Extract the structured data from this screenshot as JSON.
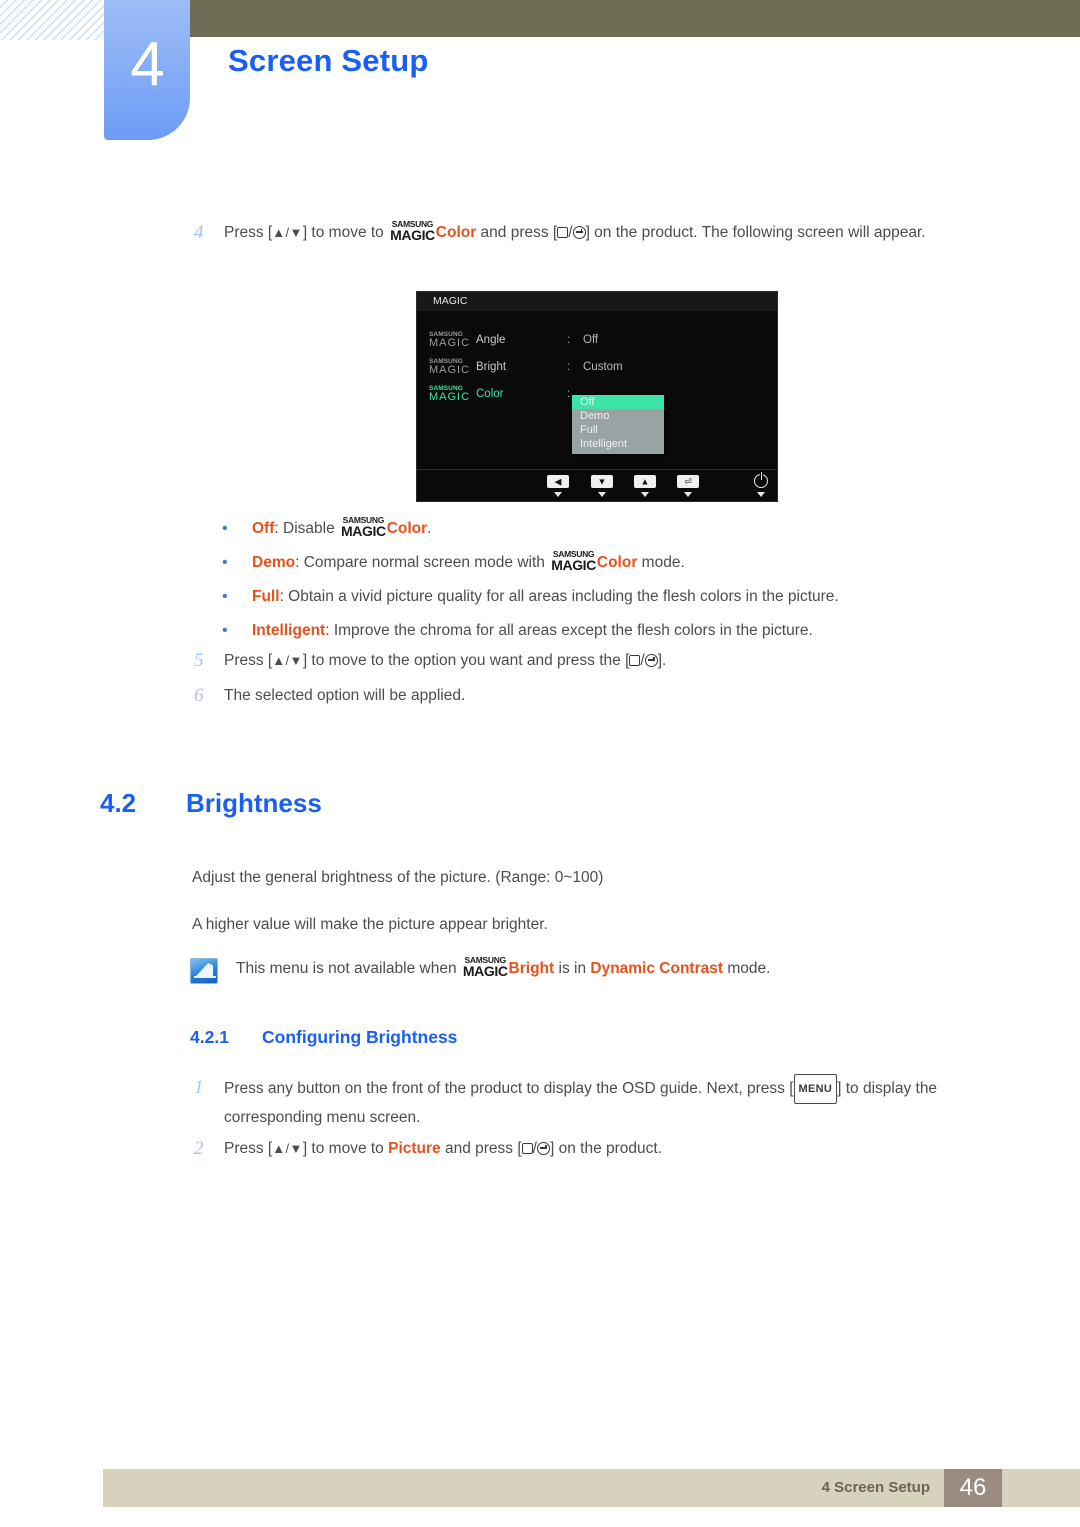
{
  "header": {
    "chapter_number": "4",
    "chapter_title": "Screen Setup"
  },
  "step4": {
    "num": "4",
    "t1": "Press [",
    "up": "▲",
    "slash": "/",
    "down": "▼",
    "t2": "] to move to ",
    "magic_s": "SAMSUNG",
    "magic_m": "MAGIC",
    "color": "Color",
    "t3": " and press [",
    "t4": "/",
    "t5": "] on the product. The following screen will appear."
  },
  "osd": {
    "title": "MAGIC",
    "magic_s": "SAMSUNG",
    "magic_m": "MAGIC",
    "colon": ":",
    "rows": [
      {
        "label": "Angle",
        "value": "Off"
      },
      {
        "label": "Bright",
        "value": "Custom"
      },
      {
        "label": "Color",
        "value": ""
      }
    ],
    "options": [
      "Off",
      "Demo",
      "Full",
      "Intelligent"
    ],
    "selected_option": "Off",
    "buttons": [
      "◀",
      "▼",
      "▲",
      "⏎"
    ],
    "power_label": "power"
  },
  "bullets": [
    {
      "dot": "•",
      "key": "Off",
      "mid": ": Disable ",
      "magic_s": "SAMSUNG",
      "magic_m": "MAGIC",
      "color": "Color",
      "tail": "."
    },
    {
      "dot": "•",
      "key": "Demo",
      "mid": ": Compare normal screen mode with ",
      "magic_s": "SAMSUNG",
      "magic_m": "MAGIC",
      "color": "Color",
      "tail": " mode."
    },
    {
      "dot": "•",
      "key": "Full",
      "mid": ": Obtain a vivid picture quality for all areas including the flesh colors in the picture.",
      "magic_s": "",
      "magic_m": "",
      "color": "",
      "tail": ""
    },
    {
      "dot": "•",
      "key": "Intelligent",
      "mid": ": Improve the chroma for all areas except the flesh colors in the picture.",
      "magic_s": "",
      "magic_m": "",
      "color": "",
      "tail": ""
    }
  ],
  "step5": {
    "num": "5",
    "t1": "Press [",
    "up": "▲",
    "slash": "/",
    "down": "▼",
    "t2": "] to move to the option you want and press the [",
    "t3": "/",
    "t4": "]."
  },
  "step6": {
    "num": "6",
    "text": "The selected option will be applied."
  },
  "section42": {
    "number": "4.2",
    "title": "Brightness",
    "para1": "Adjust the general brightness of the picture. (Range: 0~100)",
    "para2": "A higher value will make the picture appear brighter.",
    "note": {
      "t1": "This menu is not available when ",
      "magic_s": "SAMSUNG",
      "magic_m": "MAGIC",
      "bright": "Bright",
      "t2": " is in ",
      "dynamic": "Dynamic Contrast",
      "t3": " mode."
    }
  },
  "section421": {
    "number": "4.2.1",
    "title": "Configuring Brightness",
    "step1": {
      "num": "1",
      "t1": "Press any button on the front of the product to display the OSD guide. Next, press [",
      "menu": "MENU",
      "t2": "] to display the corresponding menu screen."
    },
    "step2": {
      "num": "2",
      "t1": "Press [",
      "up": "▲",
      "slash": "/",
      "down": "▼",
      "t2": "] to move to ",
      "picture": "Picture",
      "t3": " and press [",
      "t4": "/",
      "t5": "] on the product."
    }
  },
  "footer": {
    "text": "4 Screen Setup",
    "page": "46"
  },
  "colors": {
    "accent_blue": "#1a5ff5",
    "orange": "#e8511c",
    "olive": "#6f6c55",
    "tab_blue": "#6e9cf5",
    "footer_bg": "#d7d2bd",
    "page_badge": "#9b8c82",
    "osd_green": "#3de4a8"
  }
}
